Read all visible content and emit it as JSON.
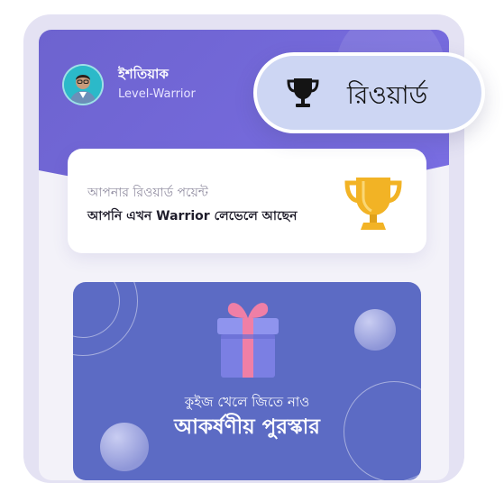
{
  "user": {
    "name": "ইশতিয়াক",
    "level": "Level-Warrior"
  },
  "points_card": {
    "title": "আপনার রিওয়ার্ড পয়েন্ট",
    "subtitle": "আপনি এখন Warrior লেভেলে আছেন",
    "icon": "trophy-icon"
  },
  "promo": {
    "line1": "কুইজ খেলে জিতে নাও",
    "line2": "আকর্ষণীয় পুরস্কার",
    "icon": "gift-icon"
  },
  "reward_badge": {
    "label": "রিওয়ার্ড",
    "icon": "trophy-outline-icon"
  },
  "colors": {
    "header": "#7a6ee3",
    "promo": "#5c6bc4",
    "trophy_gold": "#f2b325",
    "pill": "#cdd6f3",
    "gift_box": "#7b7fe3",
    "ribbon": "#ef7fa6"
  }
}
